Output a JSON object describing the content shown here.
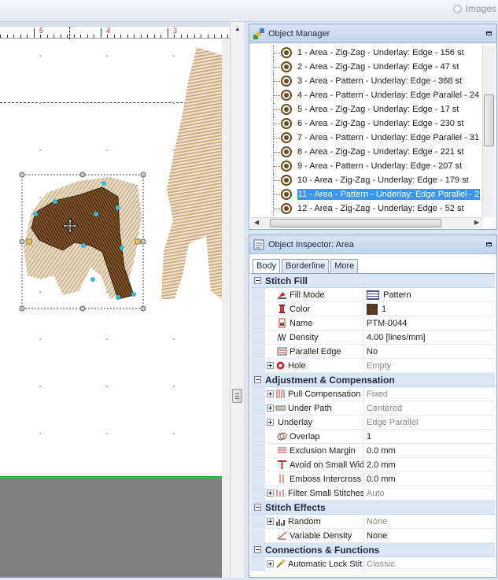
{
  "topbar": {
    "images_label": "Images"
  },
  "ruler": {
    "labels": [
      "5",
      "4",
      "3"
    ]
  },
  "object_manager": {
    "title": "Object Manager",
    "items": [
      "1 - Area - Zig-Zag - Underlay: Edge - 156 st",
      "2 - Area - Zig-Zag - Underlay: Edge - 47 st",
      "3 - Area - Pattern - Underlay: Edge - 368 st",
      "4 - Area - Pattern - Underlay: Edge Parallel - 24",
      "5 - Area - Zig-Zag - Underlay: Edge - 17 st",
      "6 - Area - Zig-Zag - Underlay: Edge - 230 st",
      "7 - Area - Pattern - Underlay: Edge Parallel - 31",
      "8 - Area - Zig-Zag - Underlay: Edge - 221 st",
      "9 - Area - Pattern - Underlay: Edge - 207 st",
      "10 - Area - Zig-Zag - Underlay: Edge - 179 st",
      "11 - Area - Pattern - Underlay: Edge Parallel - 2",
      "12 - Area - Zig-Zag - Underlay: Edge - 52 st"
    ],
    "selected_index": 10
  },
  "object_inspector": {
    "title": "Object Inspector: Area",
    "tabs": [
      "Body",
      "Borderline",
      "More"
    ],
    "sections": {
      "stitch_fill": {
        "label": "Stitch Fill",
        "fill_mode": {
          "name": "Fill Mode",
          "value": "Pattern"
        },
        "color": {
          "name": "Color",
          "value": "1",
          "swatch": "#5a3a1e"
        },
        "name": {
          "name": "Name",
          "value": "PTM-0044"
        },
        "density": {
          "name": "Density",
          "value": "4.00 [lines/mm]"
        },
        "parallel_edge": {
          "name": "Parallel Edge",
          "value": "No"
        },
        "hole": {
          "name": "Hole",
          "value": "Empty"
        }
      },
      "adjustment": {
        "label": "Adjustment & Compensation",
        "pull_comp": {
          "name": "Pull Compensation",
          "value": "Fixed"
        },
        "under_path": {
          "name": "Under Path",
          "value": "Centered"
        },
        "underlay": {
          "name": "Underlay",
          "value": "Edge Parallel"
        },
        "overlap": {
          "name": "Overlap",
          "value": "1"
        },
        "exclusion_margin": {
          "name": "Exclusion Margin",
          "value": "0.0 mm"
        },
        "avoid_small": {
          "name": "Avoid on Small Wid",
          "value": "2.0 mm"
        },
        "emboss": {
          "name": "Emboss Intercross",
          "value": "0.0 mm"
        },
        "filter_small": {
          "name": "Filter Small Stitches",
          "value": "Auto"
        }
      },
      "effects": {
        "label": "Stitch Effects",
        "random": {
          "name": "Random",
          "value": "None"
        },
        "variable_density": {
          "name": "Variable Density",
          "value": "None"
        }
      },
      "connections": {
        "label": "Connections & Functions",
        "auto_lock": {
          "name": "Automatic Lock Stit",
          "value": "Classic"
        }
      }
    }
  }
}
